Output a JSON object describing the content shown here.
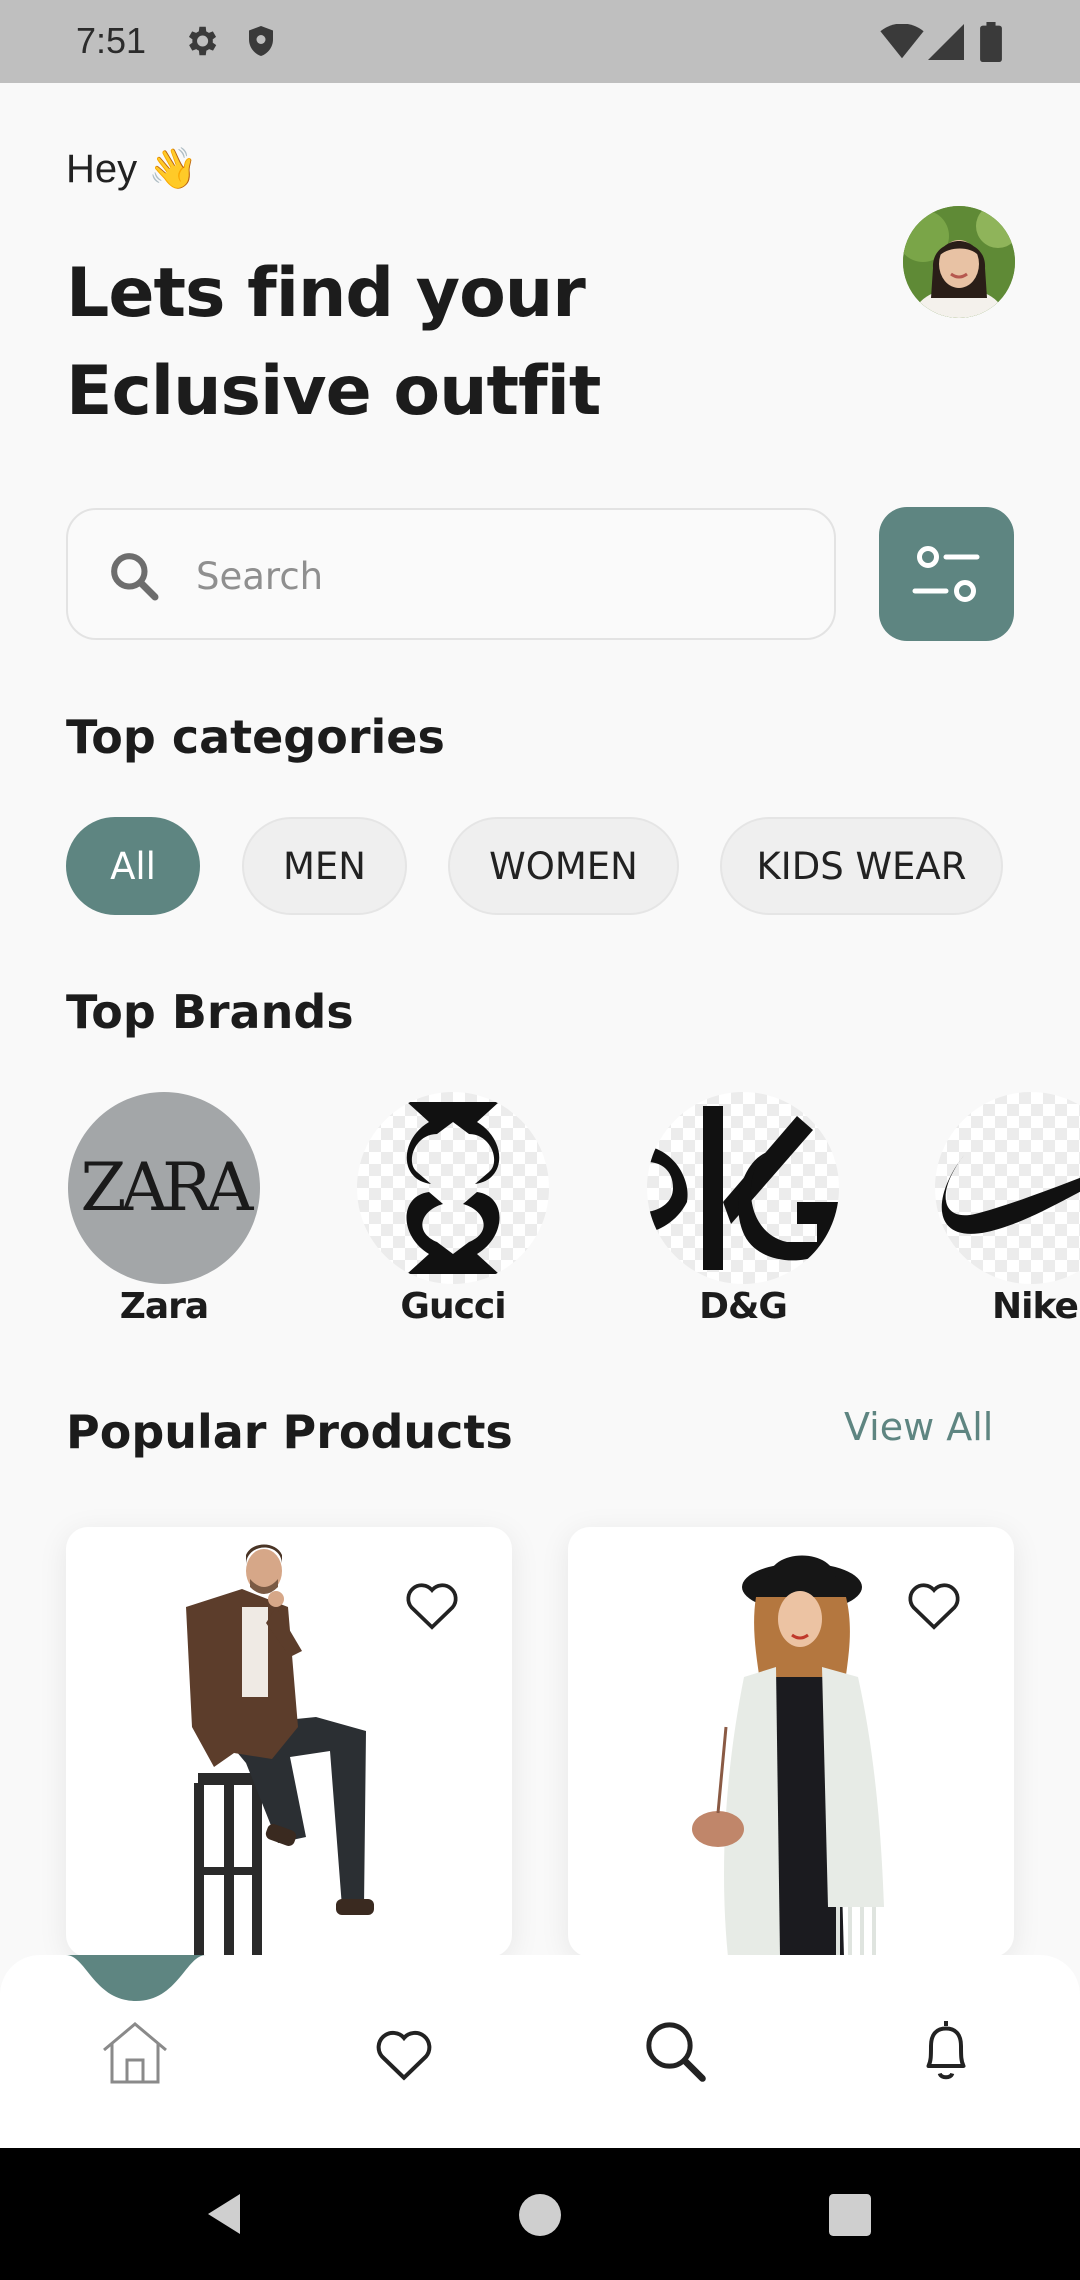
{
  "status_bar": {
    "time": "7:51"
  },
  "header": {
    "greeting": "Hey",
    "wave_emoji": "👋",
    "headline_line1": "Lets find your",
    "headline_line2": "Eclusive outfit"
  },
  "search": {
    "placeholder": "Search"
  },
  "categories": {
    "title": "Top categories",
    "items": [
      "All",
      "MEN",
      "WOMEN",
      "KIDS WEAR"
    ],
    "selected": "All"
  },
  "brands": {
    "title": "Top Brands",
    "items": [
      {
        "name": "Zara",
        "logo_text": "ZARA"
      },
      {
        "name": "Gucci"
      },
      {
        "name": "D&G"
      },
      {
        "name": "Nike"
      }
    ]
  },
  "popular": {
    "title": "Popular Products",
    "view_all": "View All"
  },
  "bottom_nav": {
    "items": [
      "home-icon",
      "heart-icon",
      "search-icon",
      "bell-icon"
    ],
    "active": "home-icon"
  },
  "colors": {
    "accent": "#5e8581",
    "status_bar": "#bfbfbf",
    "background": "#f9f9f9"
  }
}
